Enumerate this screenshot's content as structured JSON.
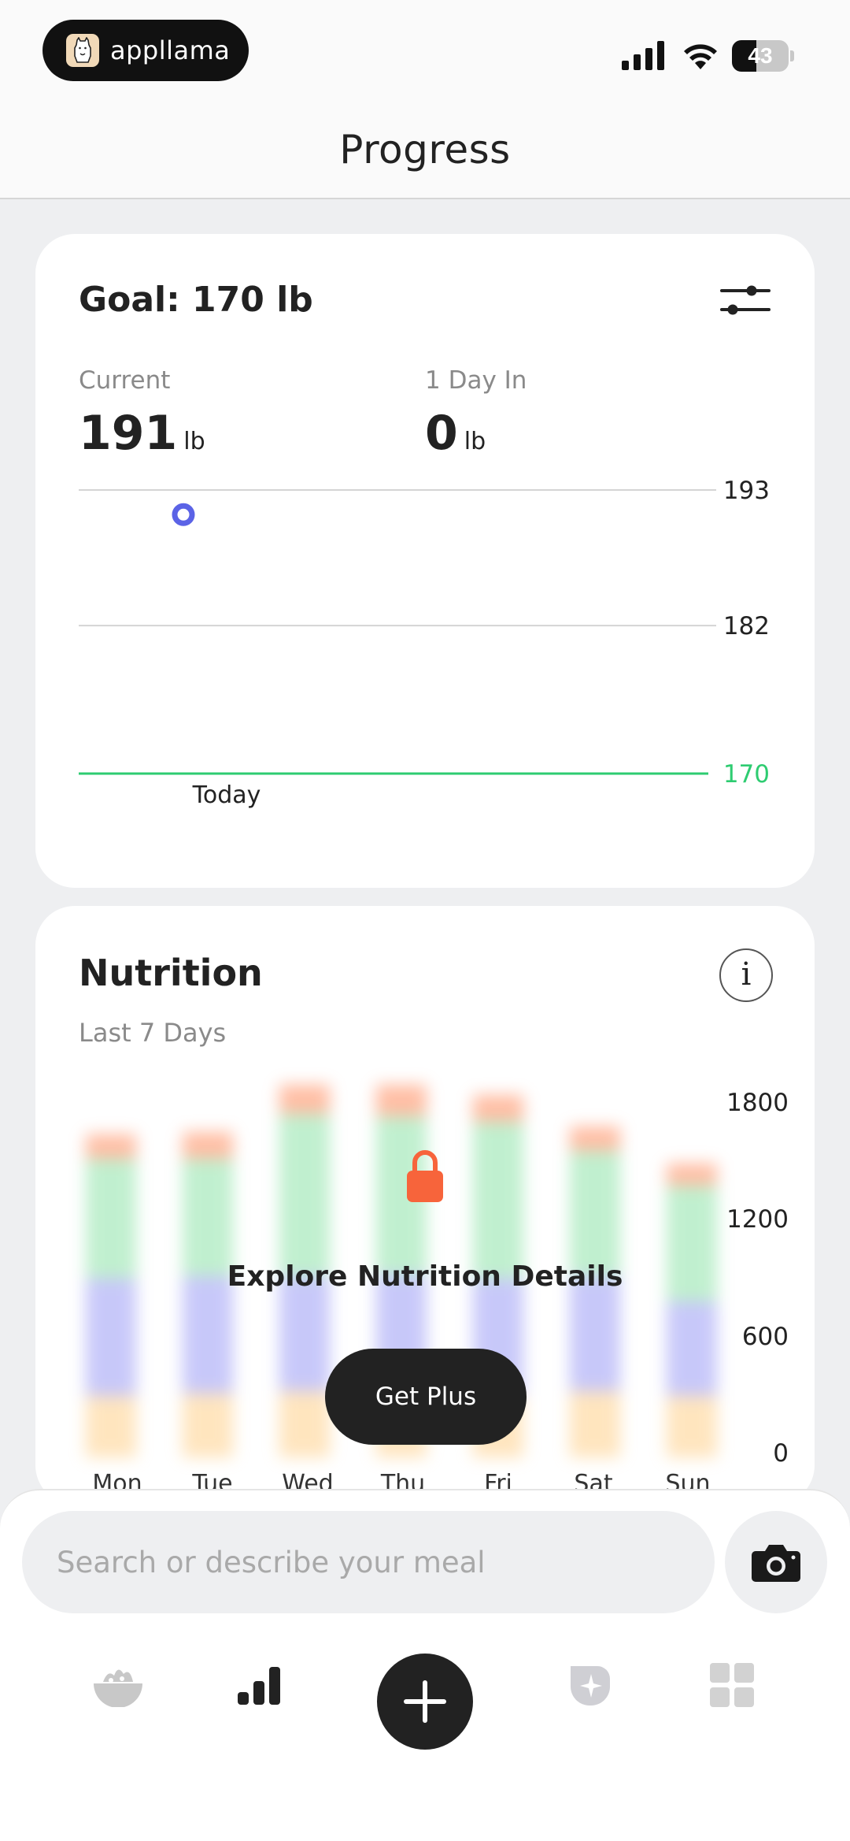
{
  "status_bar": {
    "app_badge": "appllama",
    "battery_level": "43",
    "battery_fraction": 0.43
  },
  "header": {
    "title": "Progress"
  },
  "goal_card": {
    "title": "Goal: 170 lb",
    "current": {
      "label": "Current",
      "value": "191",
      "unit": "lb"
    },
    "days_in": {
      "label": "1 Day In",
      "value": "0",
      "unit": "lb"
    }
  },
  "weight_chart": {
    "chart_data": {
      "type": "line",
      "y_ticks": [
        "193",
        "182",
        "170"
      ],
      "ylim": [
        170,
        193
      ],
      "goal_value": 170,
      "goal_color": "#2ecc71",
      "point_color": "#5b63e6",
      "points": [
        {
          "x": "Today",
          "y": 191
        }
      ],
      "x_labels": [
        "Today"
      ]
    }
  },
  "nutrition_card": {
    "title": "Nutrition",
    "info_icon": "i",
    "subtitle": "Last 7 Days",
    "locked_title": "Explore Nutrition Details",
    "cta_label": "Get Plus",
    "chart_data": {
      "type": "bar",
      "stacked": true,
      "categories": [
        "Mon",
        "Tue",
        "Wed",
        "Thu",
        "Fri",
        "Sat",
        "Sun"
      ],
      "y_ticks": [
        "1800",
        "1200",
        "600",
        "0"
      ],
      "ylim": [
        0,
        1800
      ],
      "series": [
        {
          "values": [
            300,
            310,
            320,
            320,
            300,
            320,
            300
          ],
          "color": "#ffd08a"
        },
        {
          "values": [
            570,
            570,
            560,
            570,
            570,
            560,
            460
          ],
          "color": "#9b9cf5"
        },
        {
          "values": [
            580,
            570,
            790,
            770,
            760,
            610,
            560
          ],
          "color": "#8ee3a8"
        },
        {
          "values": [
            120,
            130,
            140,
            150,
            130,
            120,
            110
          ],
          "color": "#ff8a5c"
        }
      ]
    }
  },
  "bottom_bar": {
    "search_placeholder": "Search or describe your meal",
    "nav": [
      "food-bowl-icon",
      "progress-bars-icon",
      "add-icon",
      "sparkle-badge-icon",
      "grid-icon"
    ]
  }
}
